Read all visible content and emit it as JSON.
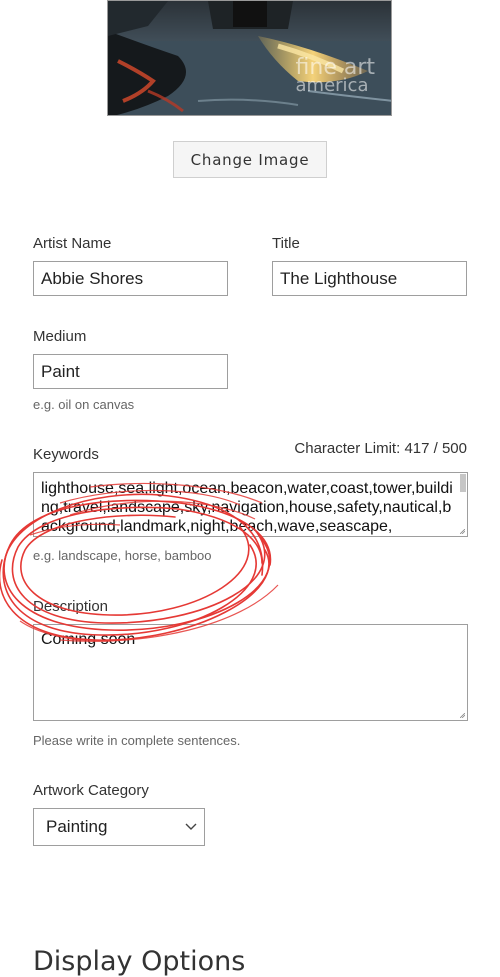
{
  "artwork": {
    "watermark_line1": "fine art",
    "watermark_line2": "america"
  },
  "change_image_label": "Change Image",
  "form": {
    "artist_name": {
      "label": "Artist Name",
      "value": "Abbie Shores"
    },
    "title": {
      "label": "Title",
      "value": "The Lighthouse"
    },
    "medium": {
      "label": "Medium",
      "value": "Paint",
      "help": "e.g. oil on canvas"
    },
    "keywords": {
      "label": "Keywords",
      "char_limit": "Character Limit: 417 / 500",
      "value": "lighthouse,sea,light,ocean,beacon,water,coast,tower,building,travel,landscape,sky,navigation,house,safety,nautical,background,landmark,night,beach,wave,seascape,",
      "help": "e.g. landscape, horse, bamboo"
    },
    "description": {
      "label": "Description",
      "value": "Coming soon",
      "help": "Please write in complete sentences."
    },
    "category": {
      "label": "Artwork Category",
      "selected": "Painting"
    }
  },
  "section_title": "Display Options",
  "icons": {
    "select_arrow": "chevron-down-icon",
    "annotation": "red-scribble-circle"
  },
  "colors": {
    "annotation": "#e53935",
    "field_border": "#9e9e9e"
  }
}
